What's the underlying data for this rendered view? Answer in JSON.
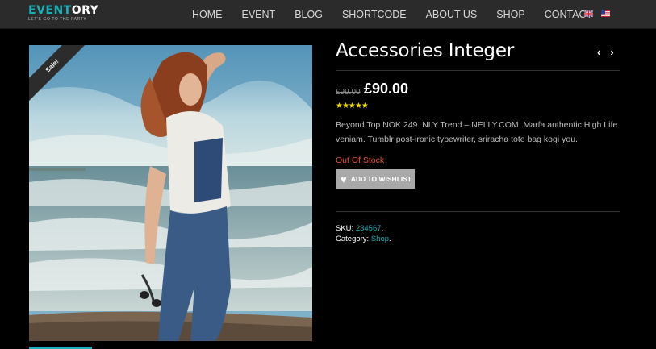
{
  "header": {
    "logo_part1": "EVENT",
    "logo_part2": "ORY",
    "tagline": "LET'S GO TO THE PARTY",
    "nav": [
      "HOME",
      "EVENT",
      "BLOG",
      "SHORTCODE",
      "ABOUT US",
      "SHOP",
      "CONTACT"
    ],
    "flags": [
      "uk-flag-icon",
      "us-flag-icon"
    ]
  },
  "product": {
    "sale_badge": "Sale!",
    "title": "Accessories Integer",
    "old_price": "£99.00",
    "price": "£90.00",
    "rating_stars": "★★★★★",
    "description": "Beyond Top NOK 249. NLY Trend – NELLY.COM. Marfa authentic High Life veniam. Tumblr post-ironic typewriter, sriracha tote bag kogi you.",
    "stock_status": "Out Of Stock",
    "wishlist_label": "ADD TO WISHLIST",
    "sku_label": "SKU:",
    "sku_value": "234567",
    "category_label": "Category:",
    "category_value": "Shop",
    "prev_icon": "‹",
    "next_icon": "›"
  },
  "colors": {
    "accent": "#19b0b8",
    "stock": "#e0542f",
    "stars": "#f2d600",
    "header_bg": "#2b2b2b"
  }
}
